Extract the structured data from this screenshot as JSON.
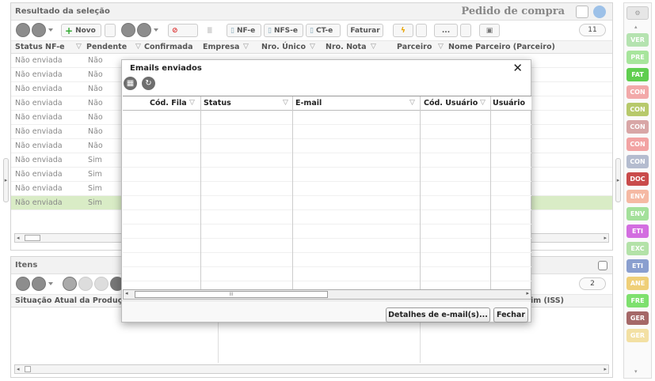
{
  "top_panel": {
    "title": "Resultado da seleção",
    "right_title": "Pedido de compra",
    "toolbar": {
      "novo": "Novo",
      "nfe": "NF-e",
      "nfse": "NFS-e",
      "cte": "CT-e",
      "faturar": "Faturar",
      "more": "...",
      "count": "11"
    },
    "columns": [
      "Status NF-e",
      "Pendente",
      "Confirmada",
      "Empresa",
      "Nro. Único",
      "Nro. Nota",
      "Parceiro",
      "Nome Parceiro (Parceiro)"
    ],
    "rows": [
      {
        "status": "Não enviada",
        "pendente": "Não"
      },
      {
        "status": "Não enviada",
        "pendente": "Não"
      },
      {
        "status": "Não enviada",
        "pendente": "Não"
      },
      {
        "status": "Não enviada",
        "pendente": "Não"
      },
      {
        "status": "Não enviada",
        "pendente": "Não"
      },
      {
        "status": "Não enviada",
        "pendente": "Não"
      },
      {
        "status": "Não enviada",
        "pendente": "Não"
      },
      {
        "status": "Não enviada",
        "pendente": "Sim"
      },
      {
        "status": "Não enviada",
        "pendente": "Sim"
      },
      {
        "status": "Não enviada",
        "pendente": "Sim"
      },
      {
        "status": "Não enviada",
        "pendente": "Sim"
      }
    ]
  },
  "bottom_panel": {
    "title": "Itens",
    "count": "2",
    "columns": [
      "Situação Atual da Produçã",
      "im (ISS)"
    ]
  },
  "modal": {
    "title": "Emails enviados",
    "close": "✕",
    "columns": [
      "Cód. Fila",
      "Status",
      "E-mail",
      "Cód. Usuário",
      "Usuário"
    ],
    "scroll_grip": "III",
    "details_button": "Detalhes de e-mail(s)...",
    "close_button": "Fechar"
  },
  "sidebar": {
    "buttons": [
      {
        "label": "VER",
        "color": "#b5e3b0"
      },
      {
        "label": "PRE",
        "color": "#a7e59c"
      },
      {
        "label": "FAT",
        "color": "#5fce4f"
      },
      {
        "label": "CON",
        "color": "#f2a9a9"
      },
      {
        "label": "CON",
        "color": "#b7c96b"
      },
      {
        "label": "CON",
        "color": "#d8a6a6"
      },
      {
        "label": "CON",
        "color": "#f2a3a3"
      },
      {
        "label": "CON",
        "color": "#b4bccf"
      },
      {
        "label": "DOC",
        "color": "#c94b4b"
      },
      {
        "label": "ENV",
        "color": "#f5b9a3"
      },
      {
        "label": "ENV",
        "color": "#a3e09a"
      },
      {
        "label": "ETI",
        "color": "#d36ee0"
      },
      {
        "label": "EXC",
        "color": "#b3e2a8"
      },
      {
        "label": "ETI",
        "color": "#8a9fcf"
      },
      {
        "label": "ANE",
        "color": "#efcf78"
      },
      {
        "label": "FRE",
        "color": "#7ee06e"
      },
      {
        "label": "GER",
        "color": "#a56868"
      },
      {
        "label": "GER",
        "color": "#f3e0a3"
      }
    ]
  }
}
